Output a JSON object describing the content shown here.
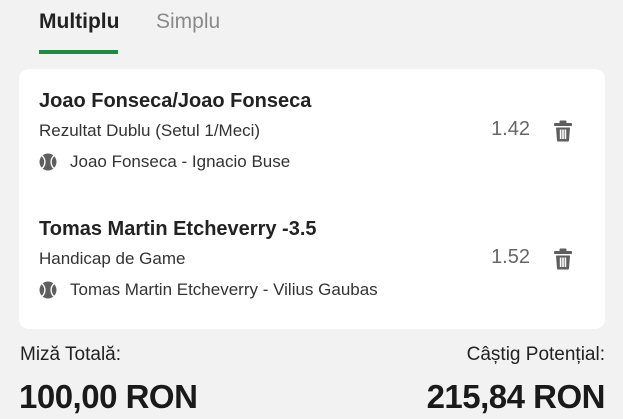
{
  "tabs": {
    "active": "Multiplu",
    "inactive": "Simplu",
    "accent_color": "#1e8a43"
  },
  "bets": [
    {
      "selection": "Joao Fonseca/Joao Fonseca",
      "market": "Rezultat Dublu (Setul 1/Meci)",
      "match": "Joao Fonseca - Ignacio Buse",
      "odds": "1.42",
      "sport_icon": "tennis-ball-icon",
      "action_icon": "trash-icon"
    },
    {
      "selection": "Tomas Martin Etcheverry -3.5",
      "market": "Handicap de Game",
      "match": "Tomas Martin Etcheverry - Vilius Gaubas",
      "odds": "1.52",
      "sport_icon": "tennis-ball-icon",
      "action_icon": "trash-icon"
    }
  ],
  "summary": {
    "stake_label": "Miză Totală:",
    "stake_value": "100,00 RON",
    "win_label": "Câștig Potențial:",
    "win_value": "215,84 RON"
  }
}
